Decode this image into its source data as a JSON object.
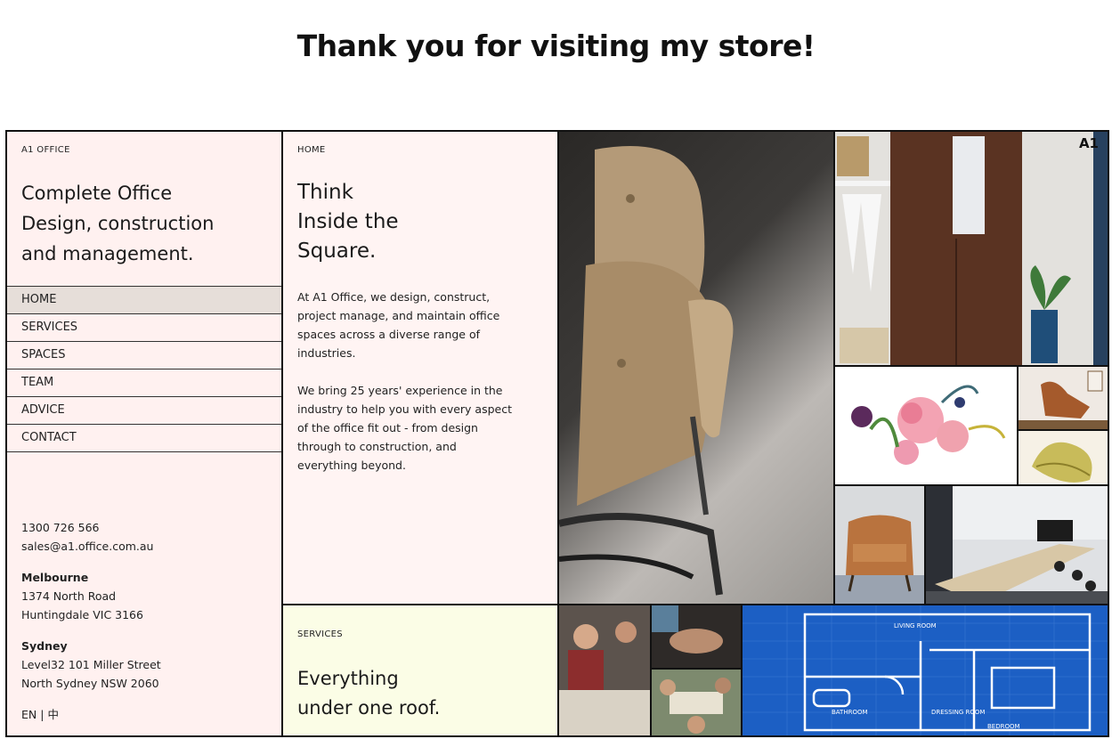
{
  "page": {
    "heading": "Thank you for visiting my store!"
  },
  "brand": {
    "label": "A1 OFFICE",
    "logo_text": "A1"
  },
  "intro": {
    "tagline_lines": [
      "Complete Office",
      "Design, construction",
      "and management."
    ]
  },
  "nav": {
    "items": [
      {
        "label": "HOME",
        "active": true
      },
      {
        "label": "SERVICES",
        "active": false
      },
      {
        "label": "SPACES",
        "active": false
      },
      {
        "label": "TEAM",
        "active": false
      },
      {
        "label": "ADVICE",
        "active": false
      },
      {
        "label": "CONTACT",
        "active": false
      }
    ]
  },
  "contact": {
    "phone": "1300 726 566",
    "email": "sales@a1.office.com.au",
    "offices": [
      {
        "city": "Melbourne",
        "line1": "1374 North Road",
        "line2": "Huntingdale VIC 3166"
      },
      {
        "city": "Sydney",
        "line1": "Level32 101 Miller Street",
        "line2": "North Sydney NSW 2060"
      }
    ]
  },
  "language": {
    "en": "EN",
    "separator": "|",
    "zh": "中"
  },
  "home": {
    "label": "HOME",
    "headline_lines": [
      "Think",
      "Inside the",
      "Square."
    ],
    "paragraphs": [
      "At A1 Office, we design, construct, project manage, and maintain office spaces across a diverse range of industries.",
      "We bring 25 years' experience in the industry to help you with every aspect of the office fit out - from design through to construction, and everything beyond."
    ]
  },
  "services": {
    "label": "SERVICES",
    "headline_lines": [
      "Everything",
      "under one roof."
    ]
  },
  "blueprint": {
    "labels": [
      "LIVING ROOM",
      "BATHROOM",
      "DRESSING ROOM",
      "BEDROOM"
    ]
  },
  "colors": {
    "panel_pink": "#fff1f0",
    "panel_yellow": "#fbfde6",
    "nav_active": "#e6ded9",
    "blueprint_blue": "#1c5fc4",
    "border": "#111111"
  }
}
